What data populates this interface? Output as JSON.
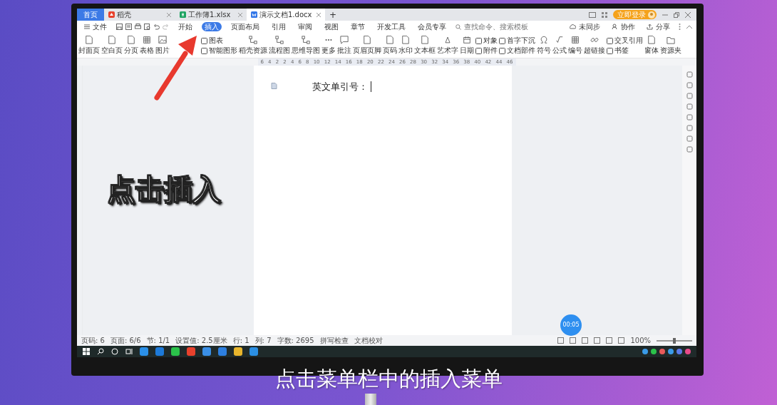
{
  "tabs": [
    {
      "kind": "home",
      "label": "首页",
      "selected": false
    },
    {
      "kind": "docer",
      "label": "稻壳",
      "selected": false
    },
    {
      "kind": "sheet",
      "label": "工作簿1.xlsx",
      "selected": false
    },
    {
      "kind": "doc",
      "label": "演示文档1.docx",
      "selected": true
    }
  ],
  "tab_add": "+",
  "login_button": "立即登录",
  "file_menu": "文件",
  "menu": [
    {
      "label": "开始",
      "selected": false
    },
    {
      "label": "插入",
      "selected": true
    },
    {
      "label": "页面布局",
      "selected": false
    },
    {
      "label": "引用",
      "selected": false
    },
    {
      "label": "审阅",
      "selected": false
    },
    {
      "label": "视图",
      "selected": false
    },
    {
      "label": "章节",
      "selected": false
    },
    {
      "label": "开发工具",
      "selected": false
    },
    {
      "label": "会员专享",
      "selected": false
    }
  ],
  "search": {
    "placeholder": "查找命令、搜索模板"
  },
  "menu_right": [
    "未同步",
    "协作",
    "分享"
  ],
  "ribbon": [
    {
      "kind": "large",
      "label": "封面页"
    },
    {
      "kind": "large",
      "label": "空白页"
    },
    {
      "kind": "large",
      "label": "分页"
    },
    {
      "kind": "large",
      "label": "表格"
    },
    {
      "kind": "large",
      "label": "图片"
    },
    {
      "kind": "pair",
      "items": [
        "图表",
        "智能图形"
      ]
    },
    {
      "kind": "large",
      "label": "稻壳资源"
    },
    {
      "kind": "large",
      "label": "流程图"
    },
    {
      "kind": "large",
      "label": "思维导图"
    },
    {
      "kind": "large",
      "label": "更多"
    },
    {
      "kind": "large",
      "label": "批注"
    },
    {
      "kind": "large",
      "label": "页眉页脚"
    },
    {
      "kind": "large",
      "label": "页码"
    },
    {
      "kind": "large",
      "label": "水印"
    },
    {
      "kind": "large",
      "label": "文本框"
    },
    {
      "kind": "large",
      "label": "艺术字"
    },
    {
      "kind": "large",
      "label": "日期"
    },
    {
      "kind": "pair",
      "items": [
        "对象",
        "附件"
      ]
    },
    {
      "kind": "pair",
      "items": [
        "首字下沉",
        "文档部件"
      ]
    },
    {
      "kind": "large",
      "label": "符号"
    },
    {
      "kind": "large",
      "label": "公式"
    },
    {
      "kind": "large",
      "label": "编号"
    },
    {
      "kind": "large",
      "label": "超链接"
    },
    {
      "kind": "pair",
      "items": [
        "交叉引用",
        "书签"
      ]
    },
    {
      "kind": "large",
      "label": "窗体"
    },
    {
      "kind": "large",
      "label": "资源夹"
    }
  ],
  "ruler": [
    "6",
    "4",
    "2",
    "2",
    "4",
    "6",
    "8",
    "10",
    "12",
    "14",
    "16",
    "18",
    "20",
    "22",
    "24",
    "26",
    "28",
    "30",
    "32",
    "34",
    "36",
    "38",
    "40",
    "42",
    "44",
    "46"
  ],
  "document": {
    "text": "英文单引号："
  },
  "timer": "00:05",
  "status_bar": [
    "页码: 6",
    "页面: 6/6",
    "节: 1/1",
    "设置值: 2.5厘米",
    "行: 1",
    "列: 7",
    "字数: 2695",
    "拼写检查",
    "文档校对"
  ],
  "zoom": "100%",
  "zoom_slider": {
    "level": 0.5
  },
  "overlay_label": "点击插入",
  "caption": "点击菜单栏中的插入菜单"
}
